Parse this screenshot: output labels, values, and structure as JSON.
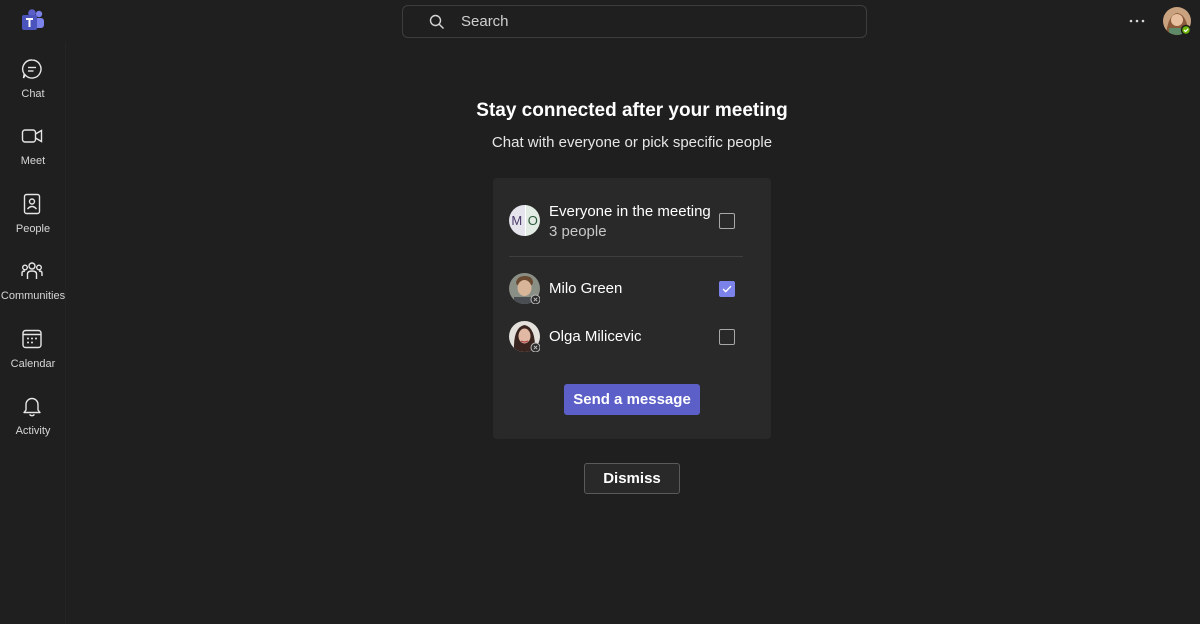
{
  "header": {
    "search_placeholder": "Search",
    "more_label": "⋯"
  },
  "rail": {
    "items": [
      {
        "label": "Chat",
        "icon": "chat-icon"
      },
      {
        "label": "Meet",
        "icon": "video-icon"
      },
      {
        "label": "People",
        "icon": "contacts-icon"
      },
      {
        "label": "Communities",
        "icon": "communities-icon"
      },
      {
        "label": "Calendar",
        "icon": "calendar-icon"
      },
      {
        "label": "Activity",
        "icon": "bell-icon"
      }
    ]
  },
  "main": {
    "title": "Stay connected after your meeting",
    "subtitle": "Chat with everyone or pick specific people",
    "group": {
      "initial_left": "M",
      "initial_right": "O",
      "title": "Everyone in the meeting",
      "count_text": "3 people",
      "checked": false
    },
    "people": [
      {
        "name": "Milo Green",
        "checked": true
      },
      {
        "name": "Olga Milicevic",
        "checked": false
      }
    ],
    "send_label": "Send a message",
    "dismiss_label": "Dismiss"
  },
  "colors": {
    "background": "#1f1f1f",
    "card": "#292929",
    "accent": "#5b5fc7",
    "checkbox_checked": "#7b83eb",
    "presence_available": "#6bb700"
  }
}
